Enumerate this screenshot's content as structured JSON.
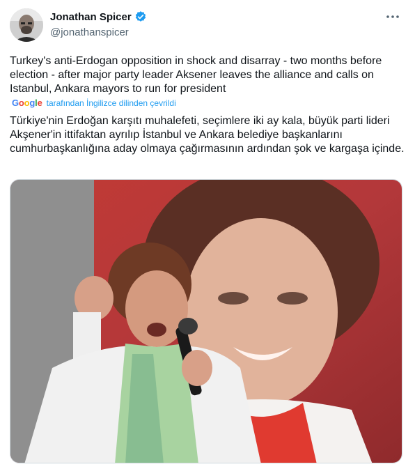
{
  "author": {
    "display_name": "Jonathan Spicer",
    "handle": "@jonathanspicer",
    "avatar_icon": "person-avatar",
    "verified_icon": "verified-badge-icon",
    "verified_color": "#1d9bf0"
  },
  "more_icon": "more-options-icon",
  "tweet": {
    "text_en": "Turkey's anti-Erdogan opposition in shock and disarray - two months before election - after major party leader Aksener leaves the alliance and calls on Istanbul, Ankara mayors to run for president",
    "translation_brand": "Google",
    "translation_note": "tarafından İngilizce dilinden çevrildi",
    "text_tr": "Türkiye'nin Erdoğan karşıtı muhalefeti, seçimlere iki ay kala, büyük parti lideri Akşener'in ittifaktan ayrılıp İstanbul ve Ankara belediye başkanlarını cumhurbaşkanlığına aday olmaya çağırmasının ardından şok ve kargaşa içinde."
  },
  "colors": {
    "text": "#0f1419",
    "secondary": "#536471",
    "link": "#1d9bf0"
  }
}
